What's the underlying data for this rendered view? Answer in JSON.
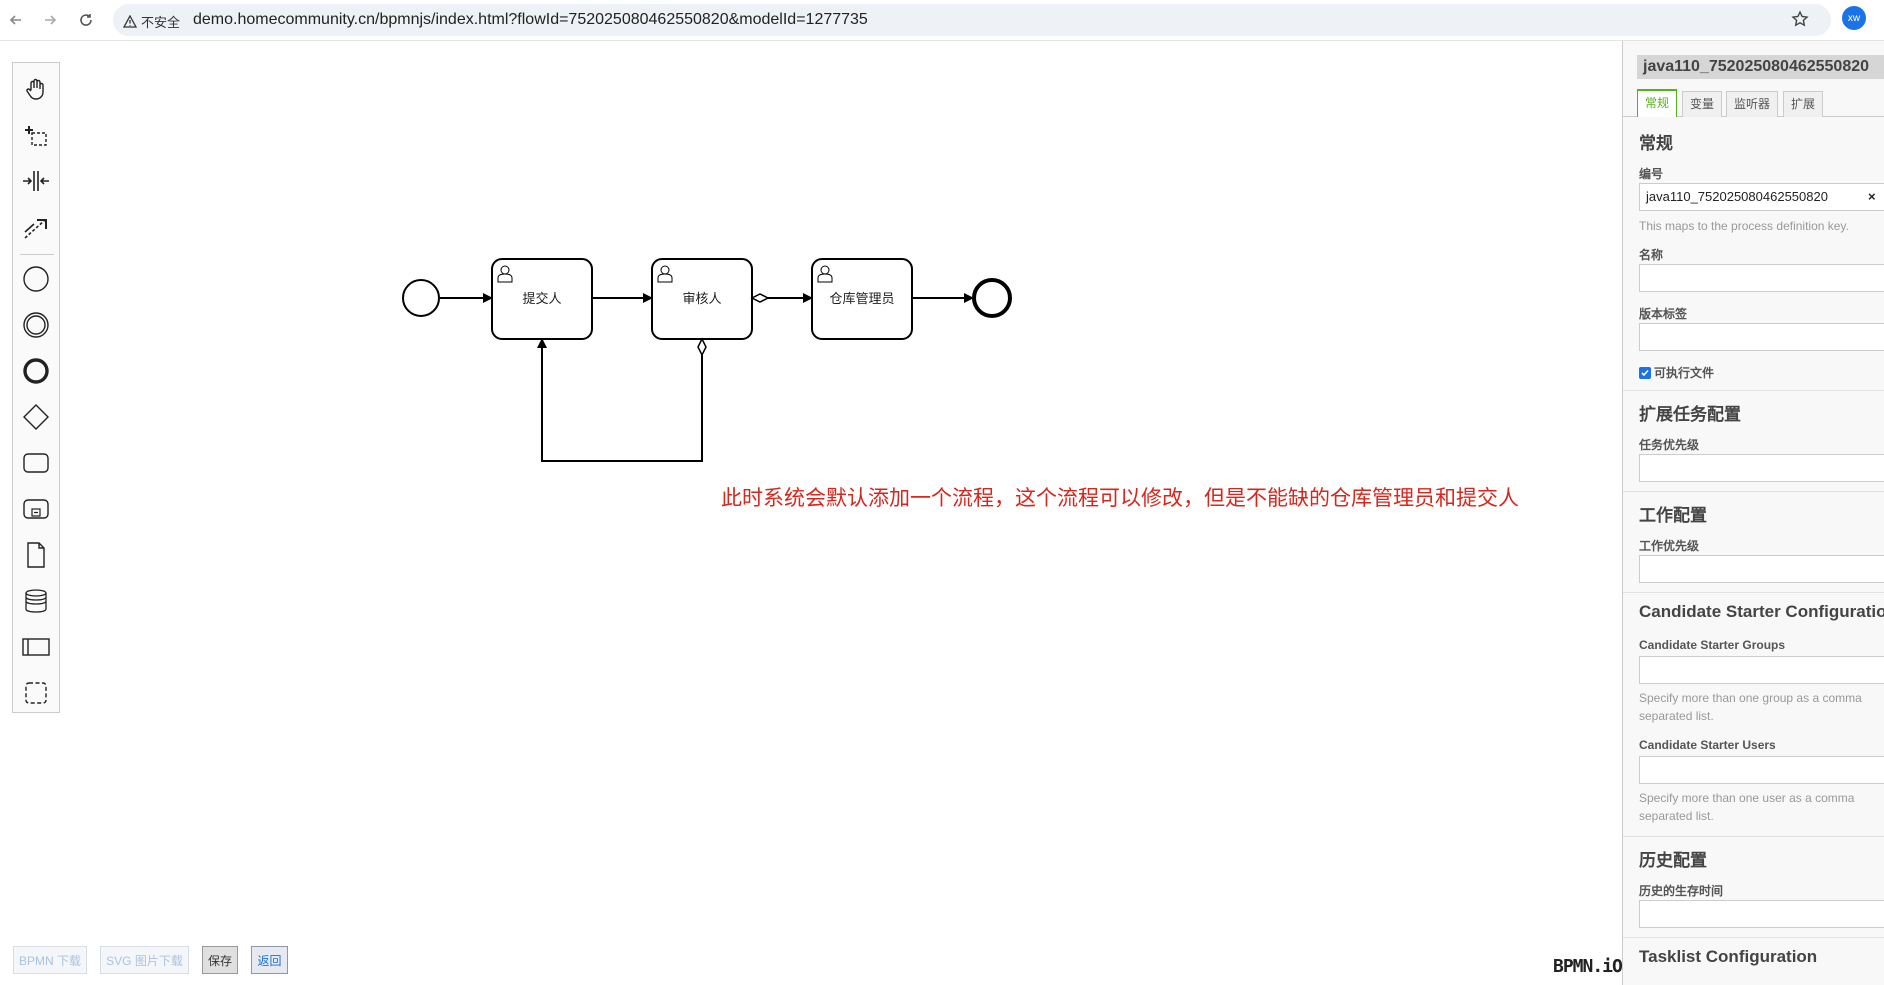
{
  "browser": {
    "security_label": "不安全",
    "url": "demo.homecommunity.cn/bpmnjs/index.html?flowId=752025080462550820&modelId=1277735",
    "profile_initials": "xw"
  },
  "palette": {
    "tools": [
      "hand-tool",
      "lasso-tool",
      "space-tool",
      "global-connect-tool",
      "start-event",
      "intermediate-event",
      "end-event",
      "gateway",
      "task",
      "subprocess",
      "data-object",
      "data-store",
      "participant",
      "group"
    ]
  },
  "diagram": {
    "tasks": [
      {
        "label": "提交人"
      },
      {
        "label": "审核人"
      },
      {
        "label": "仓库管理员"
      }
    ]
  },
  "annotation": "此时系统会默认添加一个流程，这个流程可以修改，但是不能缺的仓库管理员和提交人",
  "bottom": {
    "bpmn_download": "BPMN 下载",
    "svg_download": "SVG 图片下载",
    "save": "保存",
    "back": "返回",
    "brand": "BPMN.iO"
  },
  "panel": {
    "header": "java110_752025080462550820",
    "tabs": [
      {
        "label": "常规"
      },
      {
        "label": "变量"
      },
      {
        "label": "监听器"
      },
      {
        "label": "扩展"
      }
    ],
    "general": {
      "title": "常规",
      "id_label": "编号",
      "id_value": "java110_752025080462550820",
      "clear": "×",
      "id_hint": "This maps to the process definition key.",
      "name_label": "名称",
      "name_value": "",
      "version_label": "版本标签",
      "version_value": "",
      "executable_label": "可执行文件",
      "executable_checked": true
    },
    "ext_task": {
      "title": "扩展任务配置",
      "priority_label": "任务优先级"
    },
    "job": {
      "title": "工作配置",
      "priority_label": "工作优先级"
    },
    "candidate": {
      "title": "Candidate Starter Configuration",
      "groups_label": "Candidate Starter Groups",
      "groups_hint": "Specify more than one group as a comma separated list.",
      "users_label": "Candidate Starter Users",
      "users_hint": "Specify more than one user as a comma separated list."
    },
    "history": {
      "title": "历史配置",
      "ttl_label": "历史的生存时间"
    },
    "tasklist": {
      "title": "Tasklist Configuration"
    }
  },
  "colors": {
    "annotation": "#d9261c",
    "tab_active": "#52b415",
    "checkbox": "#1a73e8"
  }
}
